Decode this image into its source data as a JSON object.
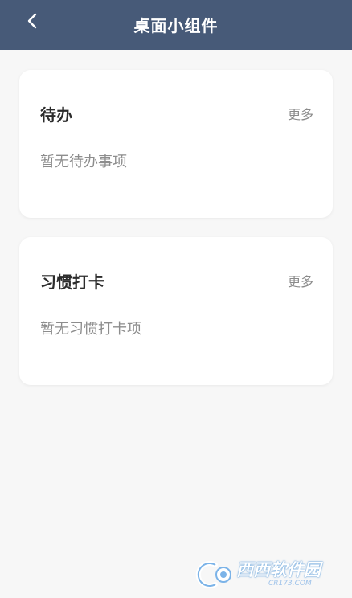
{
  "header": {
    "title": "桌面小组件",
    "back_icon": "chevron-left-icon"
  },
  "cards": [
    {
      "title": "待办",
      "more": "更多",
      "empty": "暂无待办事项"
    },
    {
      "title": "习惯打卡",
      "more": "更多",
      "empty": "暂无习惯打卡项"
    }
  ],
  "watermark": {
    "main": "西西软件园",
    "sub": "CR173.COM"
  },
  "colors": {
    "header_bg": "#475a78",
    "page_bg": "#f7f7f7",
    "card_bg": "#ffffff"
  }
}
